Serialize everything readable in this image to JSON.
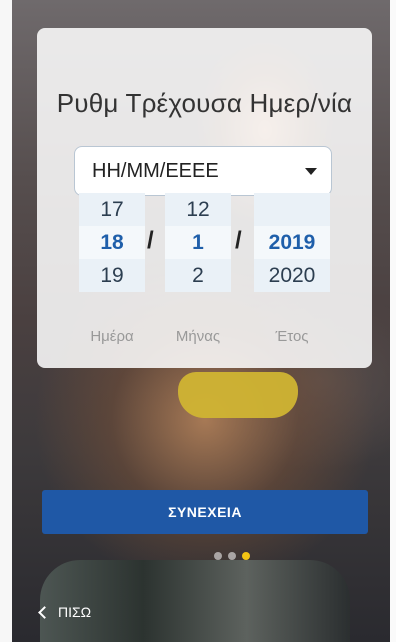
{
  "screen": {
    "title": "Ρυθμ Τρέχουσα Ημερ/νία",
    "date_format": {
      "selected": "ΗΗ/ΜΜ/ΕΕΕΕ"
    },
    "picker": {
      "day": {
        "above": "17",
        "selected": "18",
        "below": "19",
        "label": "Ημέρα"
      },
      "month": {
        "above": "12",
        "selected": "1",
        "below": "2",
        "label": "Μήνας"
      },
      "year": {
        "above": "",
        "selected": "2019",
        "below": "2020",
        "label": "Έτος"
      },
      "separator": "/"
    },
    "continue_label": "ΣΥΝΕΧΕΙΑ",
    "pagination": {
      "total": 3,
      "active_index": 2
    },
    "back_label": "ΠΙΣΩ"
  },
  "colors": {
    "primary": "#1f58a6",
    "selected_value": "#1f5faa",
    "active_dot": "#f3c514"
  }
}
